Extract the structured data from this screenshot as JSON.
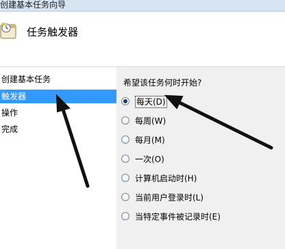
{
  "window": {
    "title": "创建基本任务向导"
  },
  "header": {
    "icon": "task-clock-icon",
    "title": "任务触发器"
  },
  "steps": [
    {
      "label": "创建基本任务",
      "active": false
    },
    {
      "label": "触发器",
      "active": true
    },
    {
      "label": "操作",
      "active": false
    },
    {
      "label": "完成",
      "active": false
    }
  ],
  "form": {
    "question": "希望该任务何时开始?",
    "options": [
      {
        "label": "每天(D)",
        "checked": true
      },
      {
        "label": "每周(W)",
        "checked": false
      },
      {
        "label": "每月(M)",
        "checked": false
      },
      {
        "label": "一次(O)",
        "checked": false
      },
      {
        "label": "计算机启动时(H)",
        "checked": false
      },
      {
        "label": "当前用户登录时(L)",
        "checked": false
      },
      {
        "label": "当特定事件被记录时(E)",
        "checked": false
      }
    ]
  },
  "colors": {
    "selection": "#3399ff",
    "panel": "#f0f0f0",
    "annotation_arrow": "#111111"
  }
}
